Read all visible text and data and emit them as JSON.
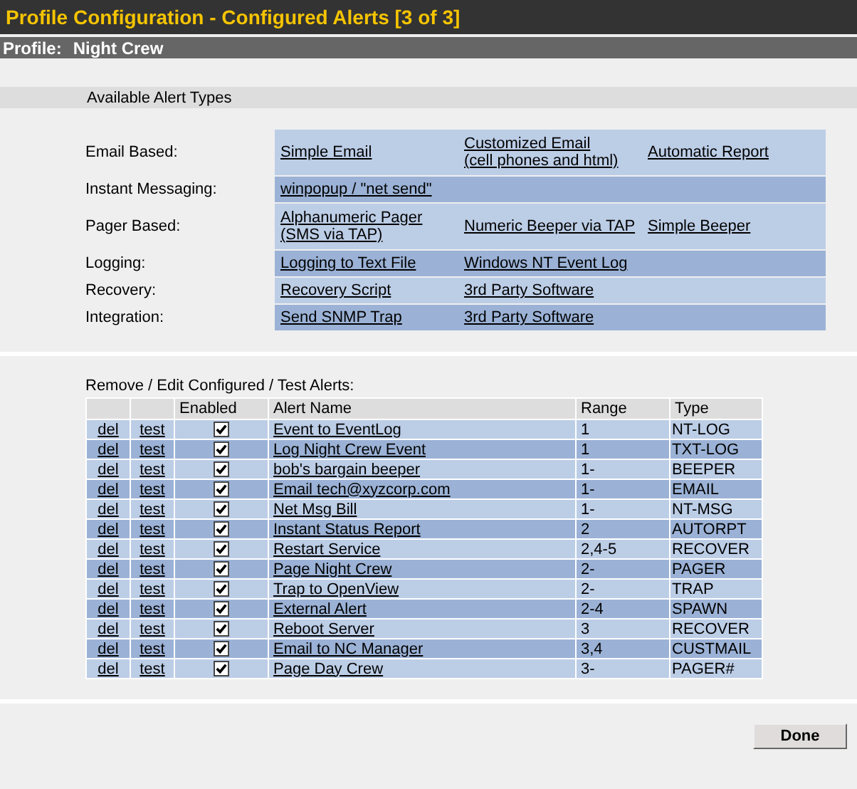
{
  "window": {
    "title": "Profile Configuration - Configured Alerts [3 of 3]"
  },
  "profile": {
    "label": "Profile:",
    "value": "Night Crew"
  },
  "available": {
    "heading": "Available Alert Types",
    "categories": [
      {
        "label": "Email Based:",
        "options": [
          "Simple Email",
          "Customized Email\n(cell phones and html)",
          "Automatic Report"
        ]
      },
      {
        "label": "Instant Messaging:",
        "options": [
          "winpopup / \"net send\""
        ]
      },
      {
        "label": "Pager Based:",
        "options": [
          "Alphanumeric Pager\n(SMS via TAP)",
          "Numeric Beeper via TAP",
          "Simple Beeper"
        ]
      },
      {
        "label": "Logging:",
        "options": [
          "Logging to Text File",
          "Windows NT Event Log"
        ]
      },
      {
        "label": "Recovery:",
        "options": [
          "Recovery Script",
          "3rd Party Software"
        ]
      },
      {
        "label": "Integration:",
        "options": [
          "Send SNMP Trap",
          "3rd Party Software"
        ]
      }
    ]
  },
  "configured": {
    "heading": "Remove / Edit Configured / Test Alerts:",
    "columns": [
      "Enabled",
      "Alert Name",
      "Range",
      "Type"
    ],
    "rows": [
      {
        "del": "del",
        "test": "test",
        "enabled": true,
        "name": "Event to EventLog",
        "range": "1",
        "type": "NT-LOG"
      },
      {
        "del": "del",
        "test": "test",
        "enabled": true,
        "name": "Log Night Crew Event",
        "range": "1",
        "type": "TXT-LOG"
      },
      {
        "del": "del",
        "test": "test",
        "enabled": true,
        "name": "bob's bargain beeper",
        "range": "1-",
        "type": "BEEPER"
      },
      {
        "del": "del",
        "test": "test",
        "enabled": true,
        "name": "Email tech@xyzcorp.com",
        "range": "1-",
        "type": "EMAIL"
      },
      {
        "del": "del",
        "test": "test",
        "enabled": true,
        "name": "Net Msg Bill",
        "range": "1-",
        "type": "NT-MSG"
      },
      {
        "del": "del",
        "test": "test",
        "enabled": true,
        "name": "Instant Status Report",
        "range": "2",
        "type": "AUTORPT"
      },
      {
        "del": "del",
        "test": "test",
        "enabled": true,
        "name": "Restart Service",
        "range": "2,4-5",
        "type": "RECOVER"
      },
      {
        "del": "del",
        "test": "test",
        "enabled": true,
        "name": "Page Night Crew",
        "range": "2-",
        "type": "PAGER"
      },
      {
        "del": "del",
        "test": "test",
        "enabled": true,
        "name": "Trap to OpenView",
        "range": "2-",
        "type": "TRAP"
      },
      {
        "del": "del",
        "test": "test",
        "enabled": true,
        "name": "External Alert",
        "range": "2-4",
        "type": "SPAWN"
      },
      {
        "del": "del",
        "test": "test",
        "enabled": true,
        "name": "Reboot Server",
        "range": "3",
        "type": "RECOVER"
      },
      {
        "del": "del",
        "test": "test",
        "enabled": true,
        "name": "Email to NC Manager",
        "range": "3,4",
        "type": "CUSTMAIL"
      },
      {
        "del": "del",
        "test": "test",
        "enabled": true,
        "name": "Page Day Crew",
        "range": "3-",
        "type": "PAGER#"
      }
    ]
  },
  "done_button": "Done"
}
